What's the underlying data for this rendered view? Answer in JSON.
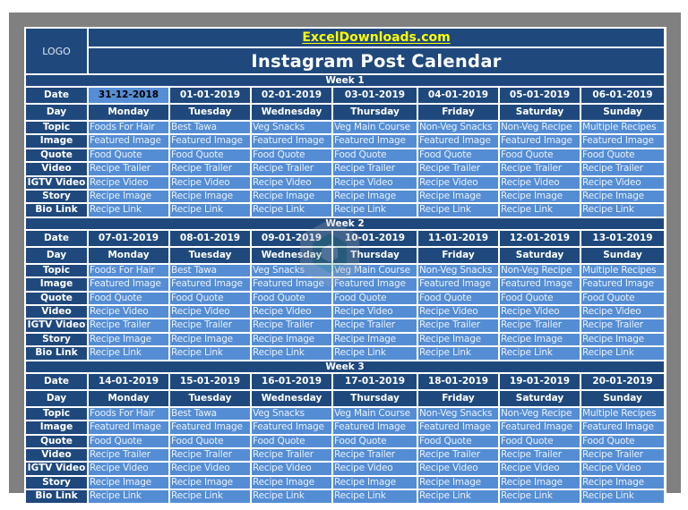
{
  "header": {
    "logo_label": "LOGO",
    "site_link": "ExcelDownloads.com",
    "title": "Instagram Post Calendar"
  },
  "row_labels": {
    "date": "Date",
    "day": "Day",
    "topic": "Topic",
    "image": "Image",
    "quote": "Quote",
    "video": "Video",
    "igtv": "IGTV Video",
    "story": "Story",
    "bio": "Bio Link"
  },
  "colors": {
    "dark_header": "#1F497D",
    "light_cell": "#548DD4",
    "link_yellow": "#FFFF00",
    "frame_gray": "#808080"
  },
  "selected_cell": "weeks.0.days.0.date",
  "weeks": [
    {
      "label": "Week  1",
      "days": [
        {
          "date": "31-12-2018",
          "day": "Monday",
          "topic": "Foods For Hair",
          "image": "Featured Image",
          "quote": "Food Quote",
          "video": "Recipe Trailer",
          "igtv": "Recipe Video",
          "story": "Recipe Image",
          "bio": "Recipe Link"
        },
        {
          "date": "01-01-2019",
          "day": "Tuesday",
          "topic": "Best Tawa",
          "image": "Featured Image",
          "quote": "Food Quote",
          "video": "Recipe Trailer",
          "igtv": "Recipe Video",
          "story": "Recipe Image",
          "bio": "Recipe Link"
        },
        {
          "date": "02-01-2019",
          "day": "Wednesday",
          "topic": "Veg Snacks",
          "image": "Featured Image",
          "quote": "Food Quote",
          "video": "Recipe Trailer",
          "igtv": "Recipe Video",
          "story": "Recipe Image",
          "bio": "Recipe Link"
        },
        {
          "date": "03-01-2019",
          "day": "Thursday",
          "topic": "Veg Main Course",
          "image": "Featured Image",
          "quote": "Food Quote",
          "video": "Recipe Trailer",
          "igtv": "Recipe Video",
          "story": "Recipe Image",
          "bio": "Recipe Link"
        },
        {
          "date": "04-01-2019",
          "day": "Friday",
          "topic": "Non-Veg Snacks",
          "image": "Featured Image",
          "quote": "Food Quote",
          "video": "Recipe Trailer",
          "igtv": "Recipe Video",
          "story": "Recipe Image",
          "bio": "Recipe Link"
        },
        {
          "date": "05-01-2019",
          "day": "Saturday",
          "topic": "Non-Veg Recipe",
          "image": "Featured Image",
          "quote": "Food Quote",
          "video": "Recipe Trailer",
          "igtv": "Recipe Video",
          "story": "Recipe Image",
          "bio": "Recipe Link"
        },
        {
          "date": "06-01-2019",
          "day": "Sunday",
          "topic": "Multiple Recipes",
          "image": "Featured Image",
          "quote": "Food Quote",
          "video": "Recipe Trailer",
          "igtv": "Recipe Video",
          "story": "Recipe Image",
          "bio": "Recipe Link"
        }
      ]
    },
    {
      "label": "Week  2",
      "days": [
        {
          "date": "07-01-2019",
          "day": "Monday",
          "topic": "Foods For Hair",
          "image": "Featured Image",
          "quote": "Food Quote",
          "video": "Recipe Video",
          "igtv": "Recipe Trailer",
          "story": "Recipe Image",
          "bio": "Recipe Link"
        },
        {
          "date": "08-01-2019",
          "day": "Tuesday",
          "topic": "Best Tawa",
          "image": "Featured Image",
          "quote": "Food Quote",
          "video": "Recipe Video",
          "igtv": "Recipe Trailer",
          "story": "Recipe Image",
          "bio": "Recipe Link"
        },
        {
          "date": "09-01-2019",
          "day": "Wednesday",
          "topic": "Veg Snacks",
          "image": "Featured Image",
          "quote": "Food Quote",
          "video": "Recipe Video",
          "igtv": "Recipe Trailer",
          "story": "Recipe Image",
          "bio": "Recipe Link"
        },
        {
          "date": "10-01-2019",
          "day": "Thursday",
          "topic": "Veg Main Course",
          "image": "Featured Image",
          "quote": "Food Quote",
          "video": "Recipe Video",
          "igtv": "Recipe Trailer",
          "story": "Recipe Image",
          "bio": "Recipe Link"
        },
        {
          "date": "11-01-2019",
          "day": "Friday",
          "topic": "Non-Veg Snacks",
          "image": "Featured Image",
          "quote": "Food Quote",
          "video": "Recipe Video",
          "igtv": "Recipe Trailer",
          "story": "Recipe Image",
          "bio": "Recipe Link"
        },
        {
          "date": "12-01-2019",
          "day": "Saturday",
          "topic": "Non-Veg Recipe",
          "image": "Featured Image",
          "quote": "Food Quote",
          "video": "Recipe Video",
          "igtv": "Recipe Trailer",
          "story": "Recipe Image",
          "bio": "Recipe Link"
        },
        {
          "date": "13-01-2019",
          "day": "Sunday",
          "topic": "Multiple Recipes",
          "image": "Featured Image",
          "quote": "Food Quote",
          "video": "Recipe Video",
          "igtv": "Recipe Trailer",
          "story": "Recipe Image",
          "bio": "Recipe Link"
        }
      ]
    },
    {
      "label": "Week  3",
      "days": [
        {
          "date": "14-01-2019",
          "day": "Monday",
          "topic": "Foods For Hair",
          "image": "Featured Image",
          "quote": "Food Quote",
          "video": "Recipe Trailer",
          "igtv": "Recipe Video",
          "story": "Recipe Image",
          "bio": "Recipe Link"
        },
        {
          "date": "15-01-2019",
          "day": "Tuesday",
          "topic": "Best Tawa",
          "image": "Featured Image",
          "quote": "Food Quote",
          "video": "Recipe Trailer",
          "igtv": "Recipe Video",
          "story": "Recipe Image",
          "bio": "Recipe Link"
        },
        {
          "date": "16-01-2019",
          "day": "Wednesday",
          "topic": "Veg Snacks",
          "image": "Featured Image",
          "quote": "Food Quote",
          "video": "Recipe Trailer",
          "igtv": "Recipe Video",
          "story": "Recipe Image",
          "bio": "Recipe Link"
        },
        {
          "date": "17-01-2019",
          "day": "Thursday",
          "topic": "Veg Main Course",
          "image": "Featured Image",
          "quote": "Food Quote",
          "video": "Recipe Trailer",
          "igtv": "Recipe Video",
          "story": "Recipe Image",
          "bio": "Recipe Link"
        },
        {
          "date": "18-01-2019",
          "day": "Friday",
          "topic": "Non-Veg Snacks",
          "image": "Featured Image",
          "quote": "Food Quote",
          "video": "Recipe Trailer",
          "igtv": "Recipe Video",
          "story": "Recipe Image",
          "bio": "Recipe Link"
        },
        {
          "date": "19-01-2019",
          "day": "Saturday",
          "topic": "Non-Veg Recipe",
          "image": "Featured Image",
          "quote": "Food Quote",
          "video": "Recipe Trailer",
          "igtv": "Recipe Video",
          "story": "Recipe Image",
          "bio": "Recipe Link"
        },
        {
          "date": "20-01-2019",
          "day": "Sunday",
          "topic": "Multiple Recipes",
          "image": "Featured Image",
          "quote": "Food Quote",
          "video": "Recipe Trailer",
          "igtv": "Recipe Video",
          "story": "Recipe Image",
          "bio": "Recipe Link"
        }
      ]
    }
  ]
}
